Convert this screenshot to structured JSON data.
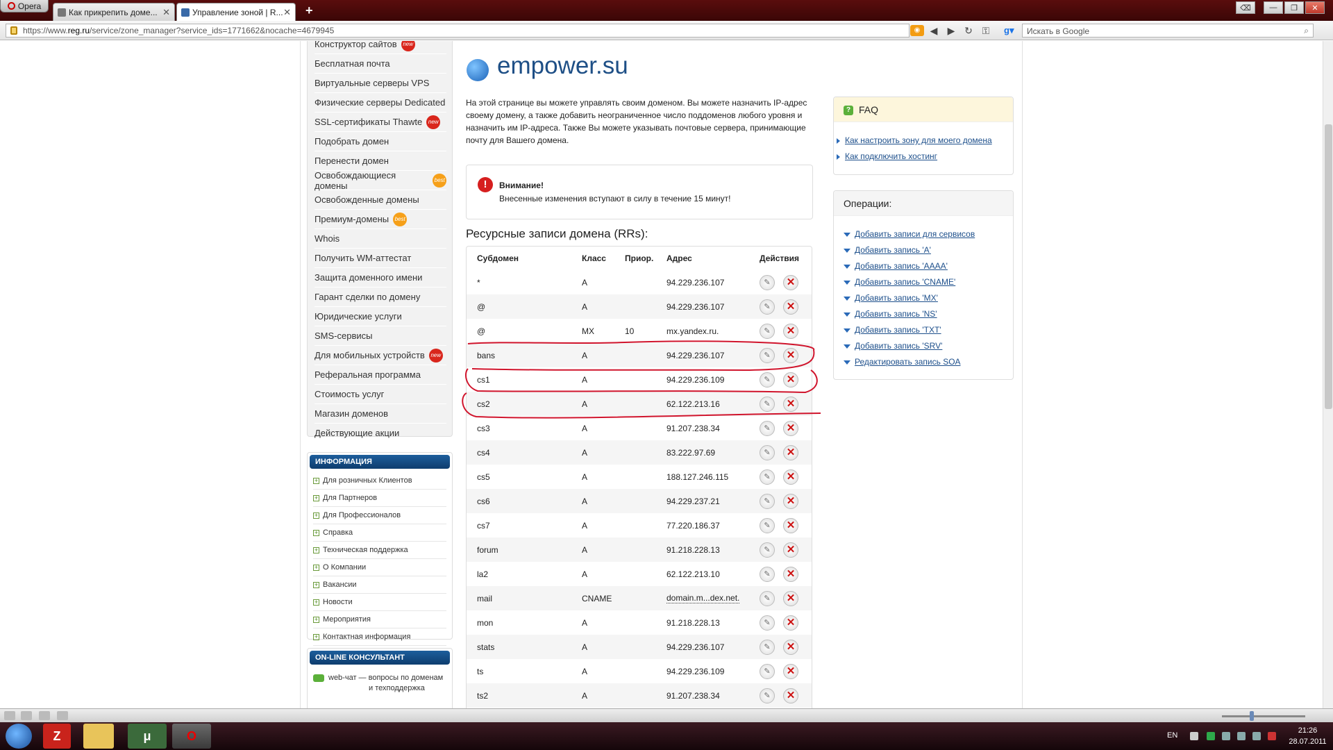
{
  "browser": {
    "menu_label": "Opera",
    "tabs": [
      {
        "label": "Как прикрепить доме...",
        "active": false
      },
      {
        "label": "Управление зоной | R...",
        "active": true
      }
    ],
    "url_prefix": "https://www.",
    "url_host": "reg.ru",
    "url_path": "/service/zone_manager?service_ids=1771662&nocache=4679945",
    "search_placeholder": "Искать в Google"
  },
  "sidebar": {
    "menu": [
      {
        "label": "Конструктор сайтов",
        "badge": "new"
      },
      {
        "label": "Бесплатная почта",
        "badge": ""
      },
      {
        "label": "Виртуальные серверы VPS",
        "badge": ""
      },
      {
        "label": "Физические серверы Dedicated",
        "badge": ""
      },
      {
        "label": "SSL-сертификаты Thawte",
        "badge": "new"
      },
      {
        "label": "Подобрать домен",
        "badge": ""
      },
      {
        "label": "Перенести домен",
        "badge": ""
      },
      {
        "label": "Освобождающиеся домены",
        "badge": "best"
      },
      {
        "label": "Освобожденные домены",
        "badge": ""
      },
      {
        "label": "Премиум-домены",
        "badge": "best"
      },
      {
        "label": "Whois",
        "badge": ""
      },
      {
        "label": "Получить WM-аттестат",
        "badge": ""
      },
      {
        "label": "Защита доменного имени",
        "badge": ""
      },
      {
        "label": "Гарант сделки по домену",
        "badge": ""
      },
      {
        "label": "Юридические услуги",
        "badge": ""
      },
      {
        "label": "SMS-сервисы",
        "badge": ""
      },
      {
        "label": "Для мобильных устройств",
        "badge": "new"
      },
      {
        "label": "Реферальная программа",
        "badge": ""
      },
      {
        "label": "Стоимость услуг",
        "badge": ""
      },
      {
        "label": "Магазин доменов",
        "badge": ""
      },
      {
        "label": "Действующие акции",
        "badge": ""
      }
    ],
    "info_title": "ИНФОРМАЦИЯ",
    "info_links": [
      "Для розничных Клиентов",
      "Для Партнеров",
      "Для Профессионалов",
      "Справка",
      "Техническая поддержка",
      "О Компании",
      "Вакансии",
      "Новости",
      "Мероприятия",
      "Контактная информация"
    ],
    "consultant_title": "ON-LINE КОНСУЛЬТАНТ",
    "consultant_line1": "web-чат — вопросы по доменам",
    "consultant_line2": "и техподдержка"
  },
  "main": {
    "domain": "empower.su",
    "intro": "На этой странице вы можете управлять своим доменом. Вы можете назначить IP-адрес своему домену, а также добавить неограниченное число поддоменов любого уровня и назначить им IP-адреса. Также Вы можете указывать почтовые сервера, принимающие почту для Вашего домена.",
    "warning_title": "Внимание!",
    "warning_text": "Внесенные изменения вступают в силу в течение 15 минут!",
    "rr_heading": "Ресурсные записи домена (RRs):",
    "columns": {
      "subdomain": "Субдомен",
      "class": "Класс",
      "prio": "Приор.",
      "address": "Адрес",
      "actions": "Действия"
    },
    "records": [
      {
        "sub": "*",
        "cls": "A",
        "prio": "",
        "addr": "94.229.236.107"
      },
      {
        "sub": "@",
        "cls": "A",
        "prio": "",
        "addr": "94.229.236.107"
      },
      {
        "sub": "@",
        "cls": "MX",
        "prio": "10",
        "addr": "mx.yandex.ru."
      },
      {
        "sub": "bans",
        "cls": "A",
        "prio": "",
        "addr": "94.229.236.107"
      },
      {
        "sub": "cs1",
        "cls": "A",
        "prio": "",
        "addr": "94.229.236.109"
      },
      {
        "sub": "cs2",
        "cls": "A",
        "prio": "",
        "addr": "62.122.213.16"
      },
      {
        "sub": "cs3",
        "cls": "A",
        "prio": "",
        "addr": "91.207.238.34"
      },
      {
        "sub": "cs4",
        "cls": "A",
        "prio": "",
        "addr": "83.222.97.69"
      },
      {
        "sub": "cs5",
        "cls": "A",
        "prio": "",
        "addr": "188.127.246.115"
      },
      {
        "sub": "cs6",
        "cls": "A",
        "prio": "",
        "addr": "94.229.237.21"
      },
      {
        "sub": "cs7",
        "cls": "A",
        "prio": "",
        "addr": "77.220.186.37"
      },
      {
        "sub": "forum",
        "cls": "A",
        "prio": "",
        "addr": "91.218.228.13"
      },
      {
        "sub": "la2",
        "cls": "A",
        "prio": "",
        "addr": "62.122.213.10"
      },
      {
        "sub": "mail",
        "cls": "CNAME",
        "prio": "",
        "addr": "domain.m...dex.net."
      },
      {
        "sub": "mon",
        "cls": "A",
        "prio": "",
        "addr": "91.218.228.13"
      },
      {
        "sub": "stats",
        "cls": "A",
        "prio": "",
        "addr": "94.229.236.107"
      },
      {
        "sub": "ts",
        "cls": "A",
        "prio": "",
        "addr": "94.229.236.109"
      },
      {
        "sub": "ts2",
        "cls": "A",
        "prio": "",
        "addr": "91.207.238.34"
      }
    ]
  },
  "faq": {
    "title": "FAQ",
    "links": [
      "Как настроить зону для моего домена",
      "Как подключить хостинг"
    ]
  },
  "operations": {
    "title": "Операции:",
    "links": [
      "Добавить записи для сервисов",
      "Добавить запись 'A'",
      "Добавить запись 'AAAA'",
      "Добавить запись 'CNAME'",
      "Добавить запись 'MX'",
      "Добавить запись 'NS'",
      "Добавить запись 'TXT'",
      "Добавить запись 'SRV'",
      "Редактировать запись SOA"
    ]
  },
  "taskbar": {
    "lang": "EN",
    "time": "21:26",
    "date": "28.07.2011"
  },
  "colors": {
    "accent": "#1e4f86",
    "danger": "#cc1111",
    "highlight_marker": "#d0142c"
  }
}
